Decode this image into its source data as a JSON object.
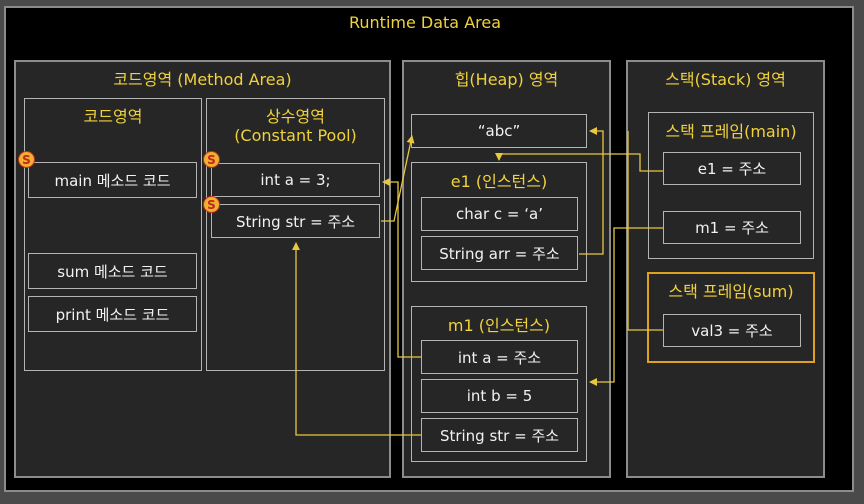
{
  "title": "Runtime Data Area",
  "method_area": {
    "title": "코드영역 (Method Area)",
    "code_area": {
      "title": "코드영역",
      "items": [
        "main 메소드 코드",
        "sum 메소드 코드",
        "print 메소드 코드"
      ]
    },
    "constant_pool": {
      "title_line1": "상수영역",
      "title_line2": "(Constant Pool)",
      "items": [
        "int a = 3;",
        "String str = 주소"
      ]
    },
    "static_badge": "S"
  },
  "heap": {
    "title": "힙(Heap) 영역",
    "literal": "“abc”",
    "e1": {
      "title": "e1 (인스턴스)",
      "fields": [
        "char c = ‘a’",
        "String arr = 주소"
      ]
    },
    "m1": {
      "title": "m1 (인스턴스)",
      "fields": [
        "int a = 주소",
        "int b = 5",
        "String str = 주소"
      ]
    }
  },
  "stack": {
    "title": "스택(Stack) 영역",
    "main_frame": {
      "title": "스택 프레임(main)",
      "vars": [
        "e1 = 주소",
        "m1 = 주소"
      ]
    },
    "sum_frame": {
      "title": "스택 프레임(sum)",
      "vars": [
        "val3 = 주소"
      ]
    }
  },
  "colors": {
    "label": "#f0d23c",
    "arrow": "#e8c840",
    "active_frame": "#e0a020",
    "border": "#b4b4b4"
  }
}
